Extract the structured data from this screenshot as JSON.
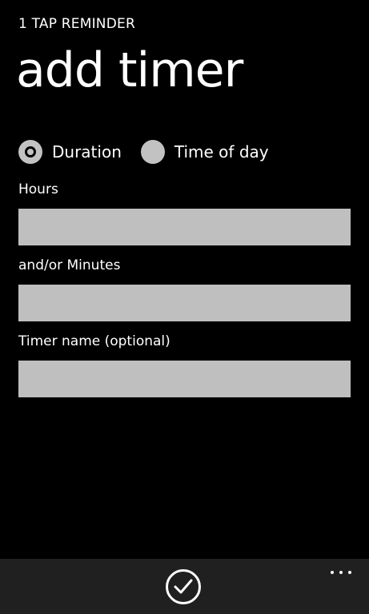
{
  "header": {
    "app_name": "1 TAP REMINDER",
    "page_title": "add timer"
  },
  "mode": {
    "options": [
      {
        "label": "Duration",
        "selected": true
      },
      {
        "label": "Time of day",
        "selected": false
      }
    ]
  },
  "form": {
    "hours": {
      "label": "Hours",
      "value": "",
      "placeholder": ""
    },
    "minutes": {
      "label": "and/or Minutes",
      "value": "",
      "placeholder": ""
    },
    "timer_name": {
      "label": "Timer name (optional)",
      "value": "",
      "placeholder": ""
    }
  },
  "app_bar": {
    "primary_icon": "checkmark-icon",
    "more_icon": "more-ellipsis-icon"
  },
  "colors": {
    "background": "#000000",
    "text": "#ffffff",
    "input_background": "#bfbfbf",
    "radio_fill": "#c2c2c2",
    "app_bar_background": "#202020"
  }
}
